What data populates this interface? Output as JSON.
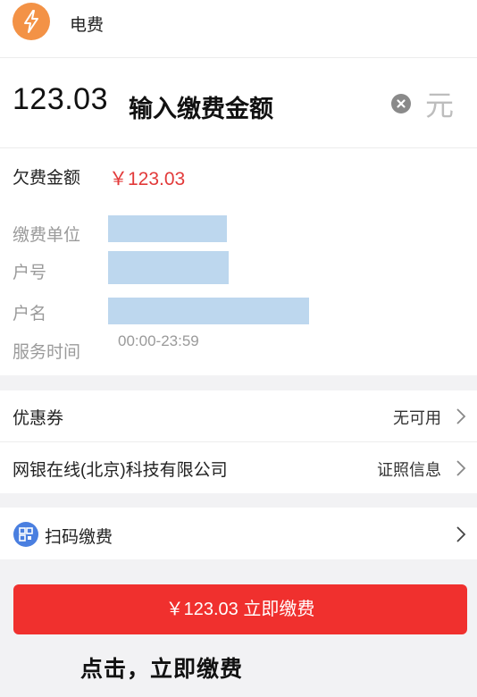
{
  "header": {
    "title": "电费",
    "logo_icon": "lightning-icon"
  },
  "amount": {
    "value": "123.03",
    "hint": "输入缴费金额",
    "unit": "元",
    "clear_icon": "clear-icon"
  },
  "info": {
    "owe_label": "欠费金额",
    "owe_amount": "￥123.03",
    "unit_label": "缴费单位",
    "account_label": "户号",
    "name_label": "户名",
    "service_time_label": "服务时间",
    "service_time": "00:00-23:59"
  },
  "coupon": {
    "label": "优惠券",
    "value": "无可用"
  },
  "company": {
    "label": "网银在线(北京)科技有限公司",
    "value": "证照信息"
  },
  "scan": {
    "label": "扫码缴费",
    "icon": "qr-scan-icon"
  },
  "pay_button": {
    "label": "￥123.03 立即缴费"
  },
  "pay_hint": "点击，立即缴费",
  "colors": {
    "accent_red": "#f0302e",
    "amount_red": "#e23a3a",
    "logo_orange": "#f39246",
    "scan_blue": "#4a7fe0"
  }
}
